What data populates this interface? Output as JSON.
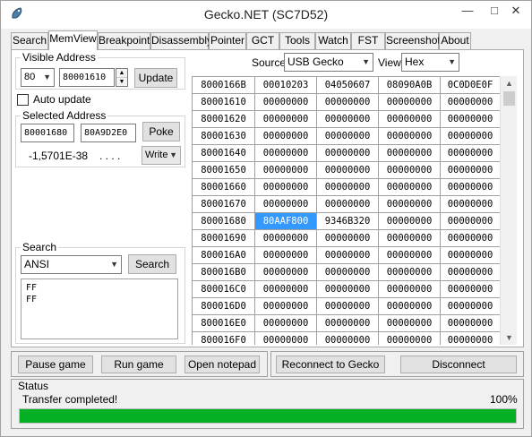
{
  "window": {
    "title": "Gecko.NET (SC7D52)",
    "minimize_glyph": "—",
    "maximize_glyph": "□",
    "close_glyph": "✕"
  },
  "tabs": [
    {
      "label": "Search"
    },
    {
      "label": "MemView"
    },
    {
      "label": "Breakpoint"
    },
    {
      "label": "Disassembly"
    },
    {
      "label": "Pointer"
    },
    {
      "label": "GCT"
    },
    {
      "label": "Tools"
    },
    {
      "label": "Watch"
    },
    {
      "label": "FST"
    },
    {
      "label": "Screenshot"
    },
    {
      "label": "About"
    }
  ],
  "visible_address": {
    "label": "Visible Address",
    "range_value": "80",
    "address_value": "80001610",
    "update_label": "Update",
    "auto_update_label": "Auto update",
    "auto_update_checked": false
  },
  "selected_address": {
    "label": "Selected Address",
    "address": "80001680",
    "value": "80A9D2E0",
    "poke_label": "Poke",
    "float_value": "-1,5701E-38",
    "ascii_value": ". . . .",
    "mode_value": "Write"
  },
  "search": {
    "label": "Search",
    "type_value": "ANSI",
    "search_label": "Search",
    "text_lines": [
      "FF",
      "FF"
    ]
  },
  "source": {
    "label": "Source:",
    "value": "USB Gecko",
    "view_label": "View:",
    "view_value": "Hex"
  },
  "memory_grid": {
    "header": [
      "8000166B",
      "00010203",
      "04050607",
      "08090A0B",
      "0C0D0E0F"
    ],
    "rows": [
      [
        "80001610",
        "00000000",
        "00000000",
        "00000000",
        "00000000"
      ],
      [
        "80001620",
        "00000000",
        "00000000",
        "00000000",
        "00000000"
      ],
      [
        "80001630",
        "00000000",
        "00000000",
        "00000000",
        "00000000"
      ],
      [
        "80001640",
        "00000000",
        "00000000",
        "00000000",
        "00000000"
      ],
      [
        "80001650",
        "00000000",
        "00000000",
        "00000000",
        "00000000"
      ],
      [
        "80001660",
        "00000000",
        "00000000",
        "00000000",
        "00000000"
      ],
      [
        "80001670",
        "00000000",
        "00000000",
        "00000000",
        "00000000"
      ],
      [
        "80001680",
        "80AAF800",
        "9346B320",
        "00000000",
        "00000000"
      ],
      [
        "80001690",
        "00000000",
        "00000000",
        "00000000",
        "00000000"
      ],
      [
        "800016A0",
        "00000000",
        "00000000",
        "00000000",
        "00000000"
      ],
      [
        "800016B0",
        "00000000",
        "00000000",
        "00000000",
        "00000000"
      ],
      [
        "800016C0",
        "00000000",
        "00000000",
        "00000000",
        "00000000"
      ],
      [
        "800016D0",
        "00000000",
        "00000000",
        "00000000",
        "00000000"
      ],
      [
        "800016E0",
        "00000000",
        "00000000",
        "00000000",
        "00000000"
      ],
      [
        "800016F0",
        "00000000",
        "00000000",
        "00000000",
        "00000000"
      ]
    ],
    "selected_cell": {
      "row": 7,
      "col": 1
    }
  },
  "buttons": {
    "pause_game": "Pause game",
    "run_game": "Run game",
    "open_notepad": "Open notepad",
    "reconnect": "Reconnect to Gecko",
    "disconnect": "Disconnect"
  },
  "status": {
    "label": "Status",
    "message": "Transfer completed!",
    "percent_label": "100%",
    "progress_fraction": 1.0
  },
  "colors": {
    "selection": "#3399ff",
    "progress": "#06b025"
  },
  "icons": {
    "app": "gecko-logo-icon",
    "dropdown": "chevron-down-icon"
  }
}
